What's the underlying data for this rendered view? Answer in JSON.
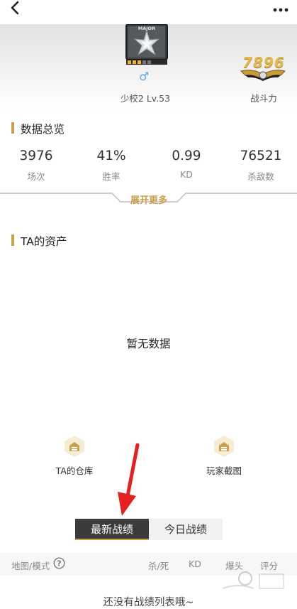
{
  "header": {
    "back_icon": "chevron-left-icon",
    "more_icon": "ellipsis-icon"
  },
  "profile": {
    "badge_text": "MAJOR",
    "gender_symbol": "♂",
    "rank_level": "少校2 Lv.53",
    "combat_power": "7896",
    "combat_power_label": "战斗力"
  },
  "stats_section": {
    "title": "数据总览",
    "items": [
      {
        "value": "3976",
        "label": "场次"
      },
      {
        "value": "41%",
        "label": "胜率"
      },
      {
        "value": "0.99",
        "label": "KD"
      },
      {
        "value": "76521",
        "label": "杀敌数"
      }
    ],
    "expand_label": "展开更多"
  },
  "assets_section": {
    "title": "TA的资产",
    "empty_text": "暂无数据"
  },
  "shortcuts": [
    {
      "label": "TA的仓库",
      "icon": "warehouse-icon"
    },
    {
      "label": "玩家截图",
      "icon": "screenshot-icon"
    }
  ],
  "tabs": [
    {
      "label": "最新战绩",
      "active": true
    },
    {
      "label": "今日战绩",
      "active": false
    }
  ],
  "table": {
    "headers": [
      "地图/模式",
      "杀/死",
      "KD",
      "爆头",
      "评分"
    ],
    "empty_text": "还没有战绩列表哦~"
  },
  "colors": {
    "accent": "#c9a04b",
    "gender": "#56a8e8",
    "tab_active_bg": "#3b3b3b"
  }
}
